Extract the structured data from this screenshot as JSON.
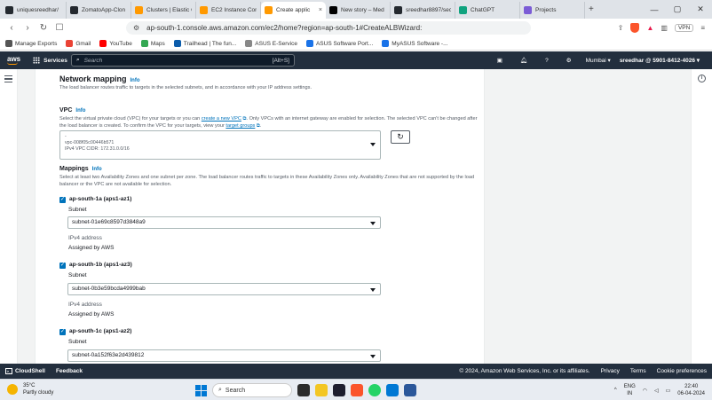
{
  "browser": {
    "tabs": [
      {
        "label": "uniquesreedhar/",
        "color": "#24292f",
        "active": false
      },
      {
        "label": "ZomatoApp-Clon",
        "color": "#24292f",
        "active": false
      },
      {
        "label": "Clusters | Elastic C",
        "color": "#ff9900",
        "active": false
      },
      {
        "label": "EC2 Instance Conn",
        "color": "#ff9900",
        "active": false
      },
      {
        "label": "Create applic",
        "color": "#ff9900",
        "active": true
      },
      {
        "label": "New story – Med",
        "color": "#000000",
        "active": false
      },
      {
        "label": "sreedhar8897/sec",
        "color": "#24292f",
        "active": false
      },
      {
        "label": "ChatGPT",
        "color": "#10a37f",
        "active": false
      },
      {
        "label": "Projects",
        "color": "#7b5cd6",
        "active": false
      }
    ],
    "url": "ap-south-1.console.aws.amazon.com/ec2/home?region=ap-south-1#CreateALBWizard:",
    "vpn_label": "VPN",
    "bookmarks": [
      {
        "label": "Manage Exports",
        "color": "#555555"
      },
      {
        "label": "Gmail",
        "color": "#ea4335"
      },
      {
        "label": "YouTube",
        "color": "#ff0000"
      },
      {
        "label": "Maps",
        "color": "#34a853"
      },
      {
        "label": "Trailhead | The fun...",
        "color": "#0b5cab"
      },
      {
        "label": "ASUS E-Service",
        "color": "#888888"
      },
      {
        "label": "ASUS Software Port...",
        "color": "#1a73e8"
      },
      {
        "label": "MyASUS Software -...",
        "color": "#1a73e8"
      }
    ]
  },
  "aws_nav": {
    "logo": "aws",
    "services_label": "Services",
    "search_placeholder": "Search",
    "search_shortcut": "[Alt+S]",
    "region": "Mumbai ▾",
    "account": "sreedhar @ 5901-8412-4026 ▾"
  },
  "network_mapping": {
    "title": "Network mapping",
    "info": "Info",
    "description": "The load balancer routes traffic to targets in the selected subnets, and in accordance with your IP address settings.",
    "vpc": {
      "label": "VPC",
      "info": "Info",
      "desc_pre": "Select the virtual private cloud (VPC) for your targets or you can ",
      "desc_link1": "create a new VPC",
      "desc_mid": ". Only VPCs with an internet gateway are enabled for selection. The selected VPC can't be changed after the load balancer is created. To confirm the VPC for your targets, view your ",
      "desc_link2": "target groups",
      "desc_end": ".",
      "select_line1": "-",
      "select_line2": "vpc-008f05c00446b571",
      "select_line3": "IPv4 VPC CIDR: 172.31.0.0/16",
      "refresh_icon": "↻"
    },
    "mappings": {
      "label": "Mappings",
      "info": "Info",
      "description": "Select at least two Availability Zones and one subnet per zone. The load balancer routes traffic to targets in these Availability Zones only. Availability Zones that are not supported by the load balancer or the VPC are not available for selection.",
      "zones": [
        {
          "name": "ap-south-1a (aps1-az1)",
          "subnet_label": "Subnet",
          "subnet": "subnet-01e69c8597d3848a9",
          "ipv4_label": "IPv4 address",
          "ipv4_value": "Assigned by AWS"
        },
        {
          "name": "ap-south-1b (aps1-az3)",
          "subnet_label": "Subnet",
          "subnet": "subnet-0b3e59bcda4999bab",
          "ipv4_label": "IPv4 address",
          "ipv4_value": "Assigned by AWS"
        },
        {
          "name": "ap-south-1c (aps1-az2)",
          "subnet_label": "Subnet",
          "subnet": "subnet-0a152f63e2d439812"
        }
      ]
    }
  },
  "footer": {
    "cloudshell": "CloudShell",
    "feedback": "Feedback",
    "copyright": "© 2024, Amazon Web Services, Inc. or its affiliates.",
    "privacy": "Privacy",
    "terms": "Terms",
    "cookies": "Cookie preferences"
  },
  "taskbar": {
    "temp": "35°C",
    "weather": "Partly cloudy",
    "search": "Search",
    "lang1": "ENG",
    "lang2": "IN",
    "time": "22:40",
    "date": "06-04-2024"
  }
}
